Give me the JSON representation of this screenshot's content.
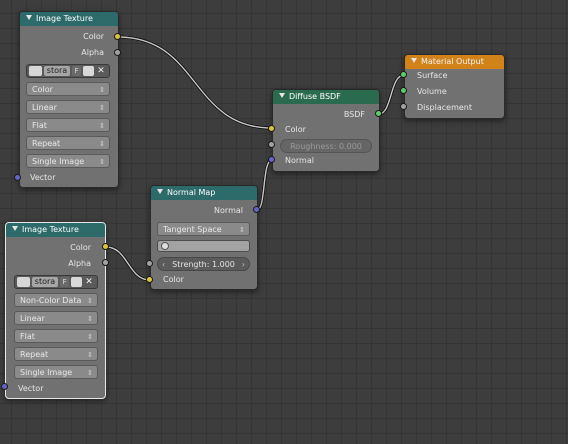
{
  "nodes": {
    "img1": {
      "title": "Image Texture",
      "out_color": "Color",
      "out_alpha": "Alpha",
      "image_name": "stora",
      "f_label": "F",
      "color_space": "Color",
      "interpolation": "Linear",
      "projection": "Flat",
      "extension": "Repeat",
      "source": "Single Image",
      "in_vector": "Vector"
    },
    "img2": {
      "title": "Image Texture",
      "out_color": "Color",
      "out_alpha": "Alpha",
      "image_name": "stora",
      "f_label": "F",
      "color_space": "Non-Color Data",
      "interpolation": "Linear",
      "projection": "Flat",
      "extension": "Repeat",
      "source": "Single Image",
      "in_vector": "Vector"
    },
    "normal_map": {
      "title": "Normal Map",
      "out_normal": "Normal",
      "space": "Tangent Space",
      "strength_label": "Strength:",
      "strength_value": "1.000",
      "in_color": "Color"
    },
    "diffuse": {
      "title": "Diffuse BSDF",
      "out_bsdf": "BSDF",
      "in_color": "Color",
      "roughness_label": "Roughness:",
      "roughness_value": "0.000",
      "in_normal": "Normal"
    },
    "output": {
      "title": "Material Output",
      "in_surface": "Surface",
      "in_volume": "Volume",
      "in_displacement": "Displacement"
    }
  },
  "colors": {
    "socket_color": "#d8c63a",
    "socket_float": "#a2a2a2",
    "socket_vector": "#6464c8",
    "socket_shader": "#5fca6a",
    "header_texture": "#2d6b6b",
    "header_shader": "#2a6b4f",
    "header_output": "#d18218"
  },
  "icons": [
    "node-collapse-triangle-icon",
    "image-browse-icon",
    "folder-open-icon",
    "unlink-x-icon",
    "uv-map-icon",
    "dropdown-arrow-icon"
  ]
}
